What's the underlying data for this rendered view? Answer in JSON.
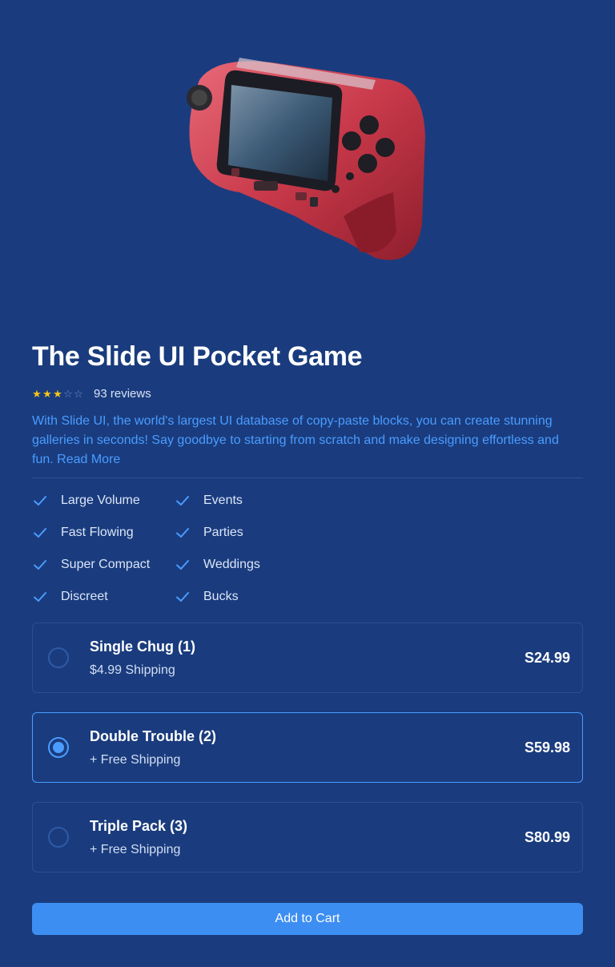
{
  "product": {
    "title": "The Slide UI Pocket Game",
    "rating": 3,
    "rating_max": 5,
    "reviews_label": "93 reviews",
    "description": "With Slide UI, the world's largest UI database of copy-paste blocks, you can create stunning galleries in seconds! Say goodbye to starting from scratch and make designing effortless and fun. ",
    "read_more": "Read More"
  },
  "features": [
    "Large Volume",
    "Events",
    "Fast Flowing",
    "Parties",
    "Super Compact",
    "Weddings",
    "Discreet",
    "Bucks"
  ],
  "options": [
    {
      "name": "Single Chug (1)",
      "subtitle": "$4.99 Shipping",
      "price": "S24.99",
      "selected": false
    },
    {
      "name": "Double Trouble (2)",
      "subtitle": "+ Free Shipping",
      "price": "S59.98",
      "selected": true
    },
    {
      "name": "Triple Pack (3)",
      "subtitle": "+ Free Shipping",
      "price": "S80.99",
      "selected": false
    }
  ],
  "cart": {
    "label": "Add to Cart"
  },
  "colors": {
    "background": "#1a3c7e",
    "accent": "#4a9cff",
    "button": "#3d8ef2",
    "star": "#f5c518",
    "device": "#c8414f"
  },
  "icons": {
    "feature": "check-icon",
    "rating": "star-icon"
  }
}
